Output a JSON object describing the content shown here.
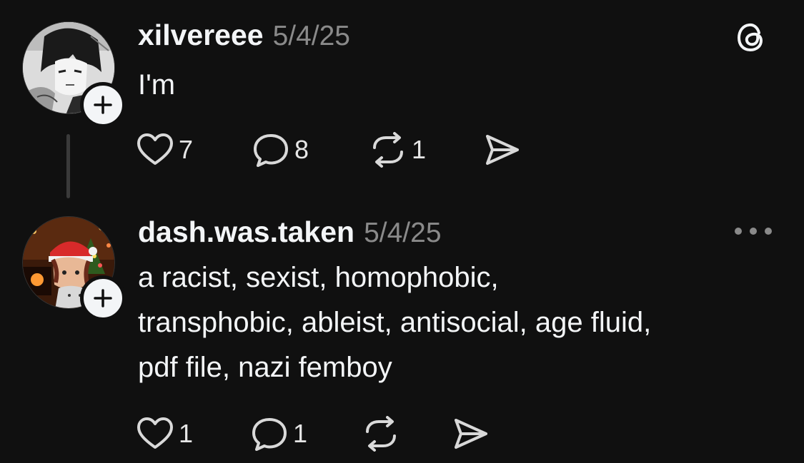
{
  "posts": [
    {
      "username": "xilvereee",
      "date": "5/4/25",
      "text": "I'm",
      "avatar_icon": "manga-avatar",
      "follow_icon": "plus-icon",
      "corner_icon": "threads-logo-icon",
      "actions": {
        "likes": "7",
        "replies": "8",
        "reposts": "1",
        "shares": ""
      }
    },
    {
      "username": "dash.was.taken",
      "date": "5/4/25",
      "text": "a racist, sexist, homophobic,\ntransphobic, ableist, antisocial, age fluid,\npdf file, nazi femboy",
      "avatar_icon": "christmas-avatar",
      "follow_icon": "plus-icon",
      "corner_icon": "more-icon",
      "actions": {
        "likes": "1",
        "replies": "1",
        "reposts": "",
        "shares": ""
      }
    }
  ],
  "colors": {
    "background": "#101010",
    "text": "#f3f5f7",
    "secondary": "#8a8a8a",
    "thread_line": "#3a3a3a"
  }
}
